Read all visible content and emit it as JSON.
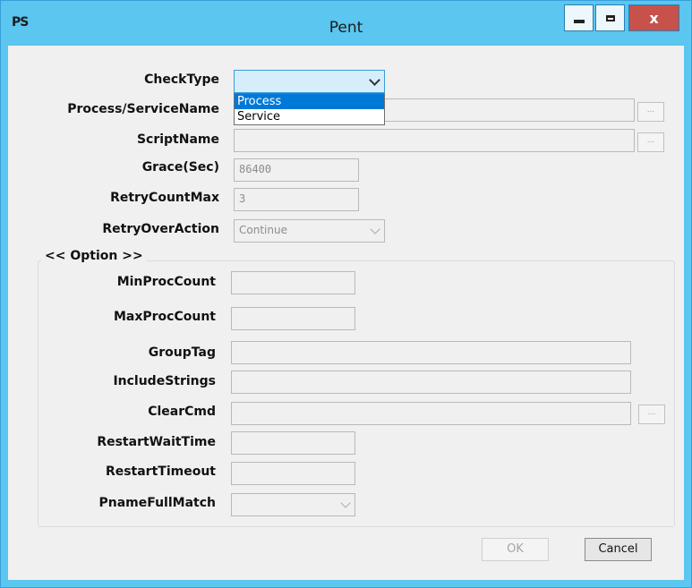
{
  "window": {
    "title": "Pent",
    "app_icon_text": "PS",
    "close_label": "x",
    "accent_color": "#5bc6ef",
    "close_color": "#c7514b"
  },
  "form": {
    "check_type": {
      "label": "CheckType",
      "value": "",
      "options": [
        "Process",
        "Service"
      ],
      "highlighted": "Process"
    },
    "process_service_name": {
      "label": "Process/ServiceName",
      "value": "",
      "browse": "..."
    },
    "script_name": {
      "label": "ScriptName",
      "value": "",
      "browse": "..."
    },
    "grace": {
      "label": "Grace(Sec)",
      "value": "86400"
    },
    "retry_count_max": {
      "label": "RetryCountMax",
      "value": "3"
    },
    "retry_over_action": {
      "label": "RetryOverAction",
      "value": "Continue"
    }
  },
  "option": {
    "title": "<< Option >>",
    "min_proc_count": {
      "label": "MinProcCount",
      "value": ""
    },
    "max_proc_count": {
      "label": "MaxProcCount",
      "value": ""
    },
    "group_tag": {
      "label": "GroupTag",
      "value": ""
    },
    "include_strings": {
      "label": "IncludeStrings",
      "value": ""
    },
    "clear_cmd": {
      "label": "ClearCmd",
      "value": "",
      "browse": "..."
    },
    "restart_wait_time": {
      "label": "RestartWaitTime",
      "value": ""
    },
    "restart_timeout": {
      "label": "RestartTimeout",
      "value": ""
    },
    "pname_full_match": {
      "label": "PnameFullMatch",
      "value": ""
    }
  },
  "buttons": {
    "ok": "OK",
    "cancel": "Cancel"
  }
}
